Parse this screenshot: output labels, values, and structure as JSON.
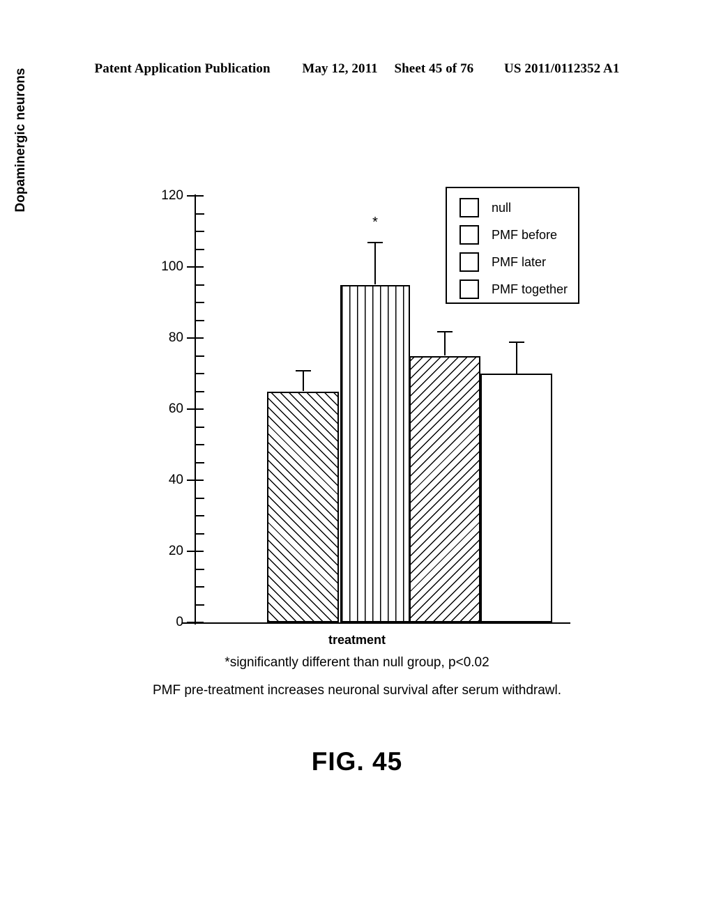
{
  "page_header": {
    "publication": "Patent Application Publication",
    "date": "May 12, 2011",
    "sheet": "Sheet 45 of 76",
    "patent_number": "US 2011/0112352 A1"
  },
  "figure": {
    "label": "FIG. 45",
    "x_axis_title": "treatment",
    "caption_significance": "*significantly different than null group, p<0.02",
    "caption_conclusion": "PMF pre-treatment increases neuronal survival after serum withdrawl."
  },
  "chart_data": {
    "type": "bar",
    "title": "",
    "xlabel": "treatment",
    "ylabel": "Dopaminergic neurons",
    "ylim": [
      0,
      120
    ],
    "ytick_labels": [
      "0",
      "20",
      "40",
      "60",
      "80",
      "100",
      "120"
    ],
    "ytick_values": [
      0,
      20,
      40,
      60,
      80,
      100,
      120
    ],
    "minor_tick_interval": 5,
    "grid": false,
    "legend_position": "top-right",
    "categories": [
      "null",
      "PMF before",
      "PMF later",
      "PMF together"
    ],
    "values": [
      65,
      95,
      75,
      70
    ],
    "error_upper": [
      6,
      12,
      7,
      9
    ],
    "error_tops": [
      71,
      107,
      82,
      79
    ],
    "annotations": [
      {
        "category": "PMF before",
        "text": "*",
        "value": 113
      }
    ],
    "series": [
      {
        "name": "Dopaminergic neurons",
        "values": [
          65,
          95,
          75,
          70
        ]
      }
    ],
    "fill_patterns": [
      "forward-diagonal",
      "vertical-lines",
      "backward-diagonal",
      "none"
    ]
  },
  "legend": {
    "items": [
      {
        "label": "null",
        "pattern": "forward-diagonal"
      },
      {
        "label": "PMF before",
        "pattern": "vertical-lines"
      },
      {
        "label": "PMF later",
        "pattern": "backward-diagonal"
      },
      {
        "label": "PMF together",
        "pattern": "none"
      }
    ]
  }
}
